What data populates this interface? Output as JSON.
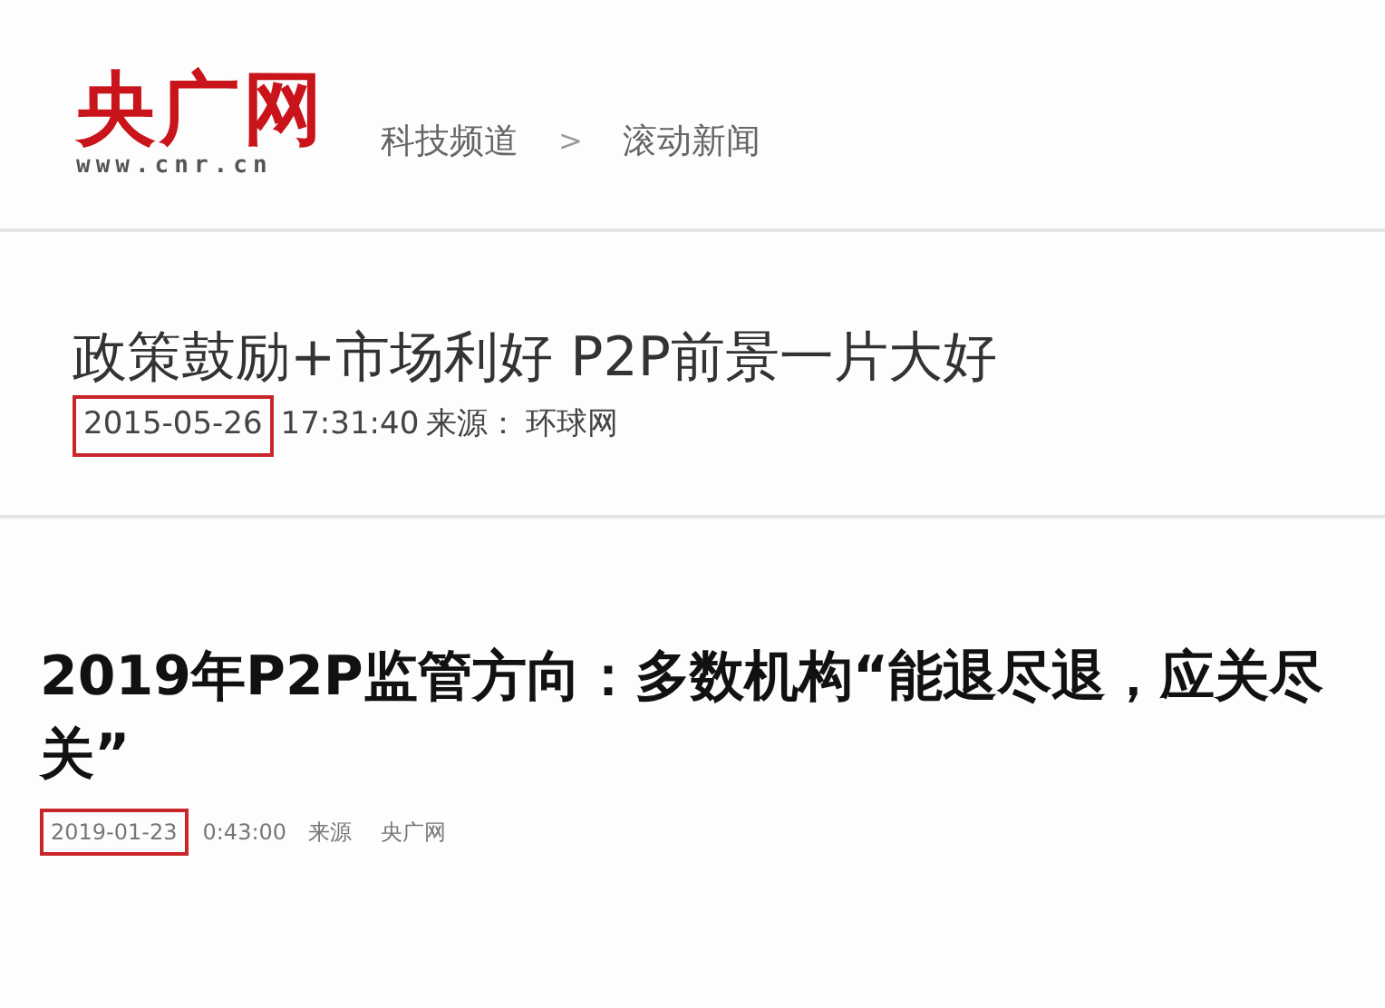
{
  "header": {
    "logo": {
      "name": "央广网",
      "url": "www.cnr.cn"
    },
    "breadcrumb": [
      {
        "kind": "link",
        "text": "科技频道"
      },
      {
        "kind": "separator",
        "text": ">"
      },
      {
        "kind": "link",
        "text": "滚动新闻"
      }
    ]
  },
  "articles": [
    {
      "kind": "light",
      "title": "政策鼓励+市场利好 P2P前景一片大好",
      "date": "2015-05-26",
      "date_highlighted": true,
      "time": "17:31:40",
      "source_label": "来源：",
      "source": "环球网"
    },
    {
      "kind": "bold",
      "title": "2019年P2P监管方向：多数机构“能退尽退，应关尽关”",
      "date": "2019-01-23",
      "date_highlighted": true,
      "time": "0:43:00",
      "source_label": "来源",
      "source": "央广网"
    }
  ]
}
